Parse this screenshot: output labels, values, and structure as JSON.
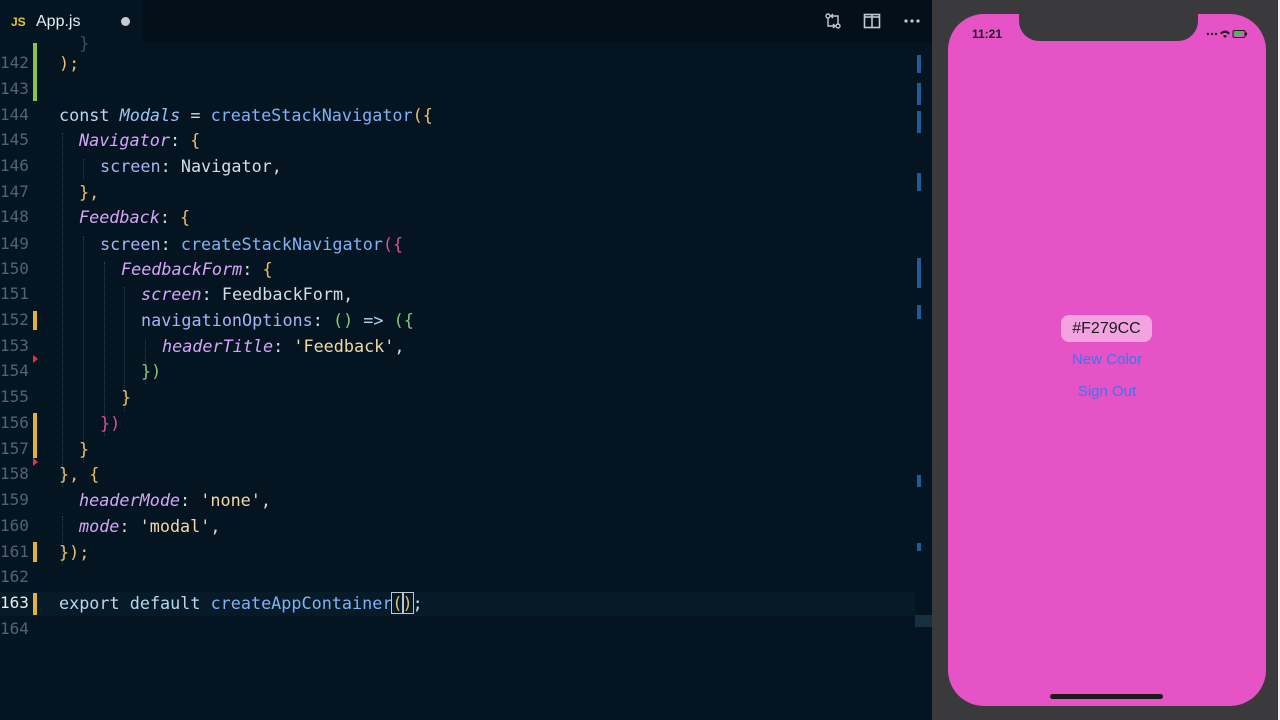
{
  "tab": {
    "badge": "JS",
    "filename": "App.js"
  },
  "toolbar": {
    "compare_icon": "compare-changes-icon",
    "split_icon": "split-editor-icon",
    "more_icon": "more-actions-icon"
  },
  "editor": {
    "lines": [
      {
        "n": "142"
      },
      {
        "n": "143"
      },
      {
        "n": "144"
      },
      {
        "n": "145"
      },
      {
        "n": "146"
      },
      {
        "n": "147"
      },
      {
        "n": "148"
      },
      {
        "n": "149"
      },
      {
        "n": "150"
      },
      {
        "n": "151"
      },
      {
        "n": "152"
      },
      {
        "n": "153"
      },
      {
        "n": "154"
      },
      {
        "n": "155"
      },
      {
        "n": "156"
      },
      {
        "n": "157"
      },
      {
        "n": "158"
      },
      {
        "n": "159"
      },
      {
        "n": "160"
      },
      {
        "n": "161"
      },
      {
        "n": "162"
      },
      {
        "n": "163"
      },
      {
        "n": "164"
      }
    ],
    "code": {
      "l142": ");",
      "l144_kw": "const ",
      "l144_name": "Modals",
      "l144_eq": " = ",
      "l144_fn": "createStackNavigator",
      "l144_open": "({",
      "l145_key": "Navigator",
      "l145_colon": ": ",
      "l145_brace": "{",
      "l146_key": "screen",
      "l146_colon": ": ",
      "l146_val": "Navigator,",
      "l147": "},",
      "l148_key": "Feedback",
      "l148_colon": ": ",
      "l148_brace": "{",
      "l149_key": "screen",
      "l149_colon": ": ",
      "l149_fn": "createStackNavigator",
      "l149_open": "({",
      "l150_key": "FeedbackForm",
      "l150_colon": ": ",
      "l150_brace": "{",
      "l151_key": "screen",
      "l151_colon": ": ",
      "l151_val": "FeedbackForm,",
      "l152_key": "navigationOptions",
      "l152_colon": ": ",
      "l152_arrow_open": "() ",
      "l152_arrow": "=>",
      "l152_open": " ({",
      "l153_key": "headerTitle",
      "l153_colon": ": ",
      "l153_str": "'Feedback'",
      "l153_comma": ",",
      "l154": "})",
      "l155": "}",
      "l156": "})",
      "l157": "}",
      "l158": "}, {",
      "l159_key": "headerMode",
      "l159_colon": ": ",
      "l159_str": "'none'",
      "l159_comma": ",",
      "l160_key": "mode",
      "l160_colon": ": ",
      "l160_str": "'modal'",
      "l160_comma": ",",
      "l161": "});",
      "l163_kw1": "export ",
      "l163_kw2": "default ",
      "l163_fn": "createAppContainer",
      "l163_open": "(",
      "l163_close": ")",
      "l163_semi": ";"
    }
  },
  "phone": {
    "time": "11:21",
    "color_hex": "#F279CC",
    "new_color_label": "New Color",
    "sign_out_label": "Sign Out",
    "screen_background": "#e553c6",
    "link_color": "#3876f0"
  }
}
